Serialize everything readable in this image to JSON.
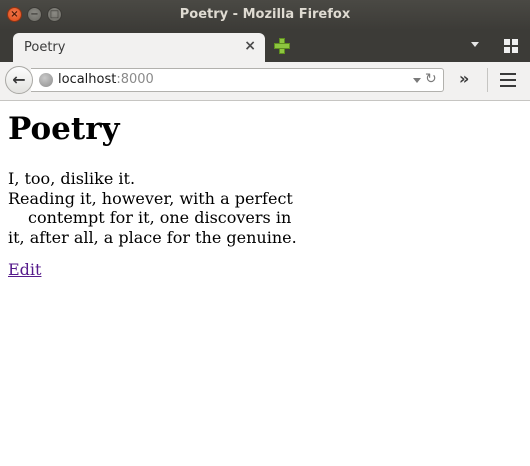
{
  "window": {
    "title": "Poetry - Mozilla Firefox"
  },
  "tabs": [
    {
      "label": "Poetry",
      "active": true
    }
  ],
  "navbar": {
    "url_host": "localhost",
    "url_port": ":8000"
  },
  "page": {
    "heading": "Poetry",
    "poem_lines": [
      "I, too, dislike it.",
      "Reading it, however, with a perfect",
      "contempt for it, one discovers in",
      "it, after all, a place for the genuine."
    ],
    "edit_link": "Edit"
  },
  "colors": {
    "titlebar": "#3c3b37",
    "close_button": "#de4a14",
    "visited_link": "#551a8b",
    "new_tab_plus": "#8dc63f"
  },
  "icons": [
    "close-icon",
    "minimize-icon",
    "maximize-icon",
    "tab-close-icon",
    "new-tab-icon",
    "tab-list-icon",
    "panorama-icon",
    "back-arrow-icon",
    "globe-icon",
    "dropdown-icon",
    "reload-icon",
    "overflow-icon",
    "menu-icon"
  ]
}
